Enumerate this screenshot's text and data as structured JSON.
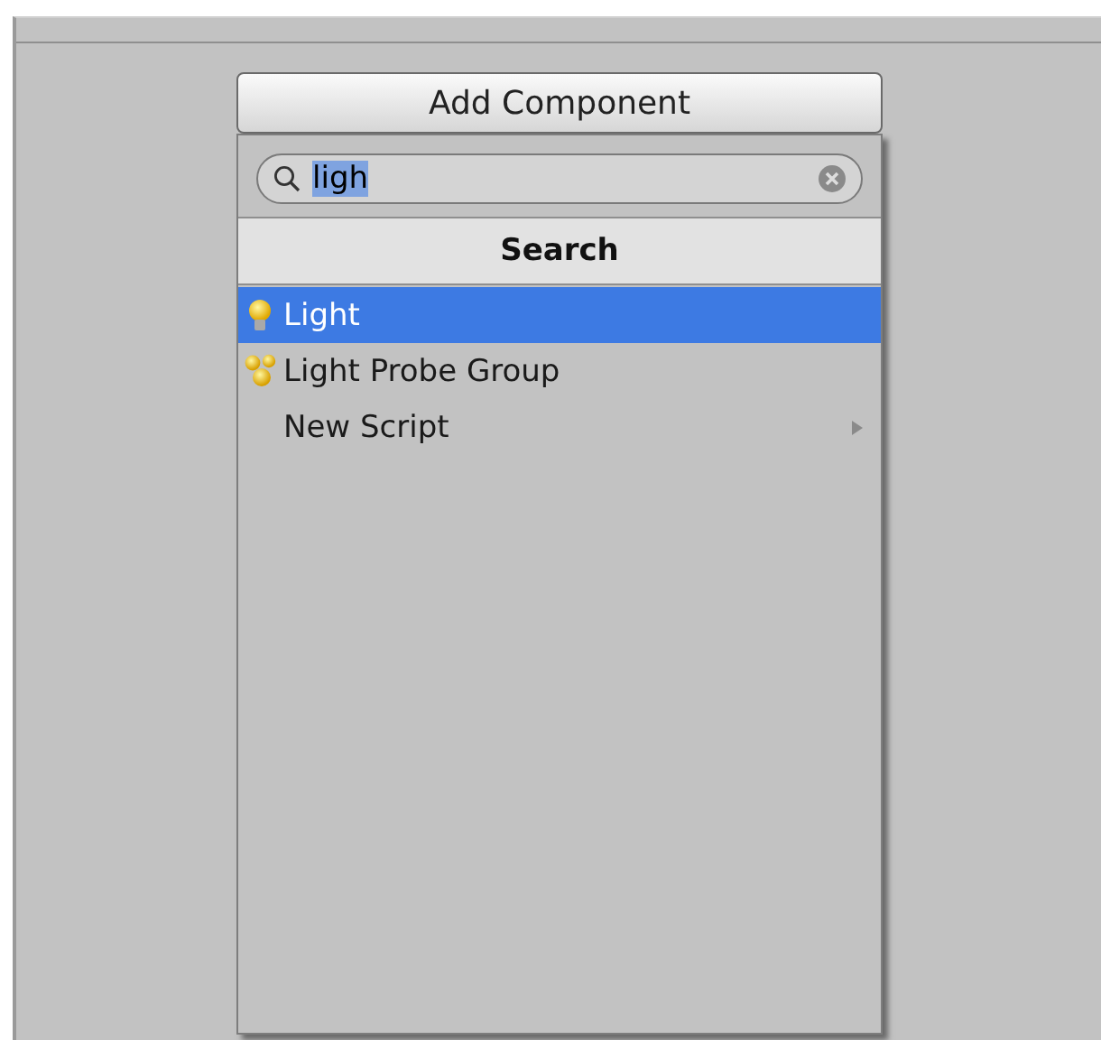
{
  "add_button": {
    "label": "Add Component"
  },
  "search": {
    "value": "ligh",
    "text_selected": true
  },
  "header": {
    "title": "Search"
  },
  "items": [
    {
      "label": "Light",
      "kind": "bulb",
      "selected": true,
      "submenu": false
    },
    {
      "label": "Light Probe Group",
      "kind": "probes",
      "selected": false,
      "submenu": false
    },
    {
      "label": "New Script",
      "kind": "plain",
      "selected": false,
      "submenu": true
    }
  ]
}
